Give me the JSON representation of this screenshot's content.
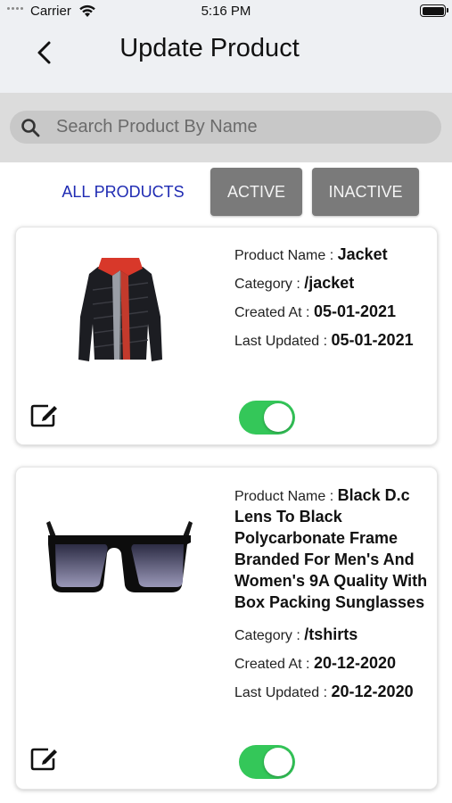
{
  "status_bar": {
    "carrier": "Carrier",
    "time": "5:16 PM"
  },
  "header": {
    "title": "Update Product",
    "back_icon": "chevron-left-icon"
  },
  "search": {
    "placeholder": "Search Product By Name",
    "value": "",
    "icon": "search-icon"
  },
  "filters": {
    "all": "ALL PRODUCTS",
    "active": "ACTIVE",
    "inactive": "INACTIVE",
    "selected": "ALL PRODUCTS"
  },
  "labels": {
    "product_name": "Product Name : ",
    "category": "Category : ",
    "created_at": "Created At : ",
    "last_updated": "Last Updated : "
  },
  "products": [
    {
      "name": "Jacket",
      "category": "/jacket",
      "created_at": "05-01-2021",
      "last_updated": "05-01-2021",
      "image": "jacket-image",
      "active": true
    },
    {
      "name": "Black D.c Lens To Black Polycarbonate Frame Branded For Men's And Women's 9A Quality With Box Packing Sunglasses",
      "category": "/tshirts",
      "created_at": "20-12-2020",
      "last_updated": "20-12-2020",
      "image": "sunglasses-image",
      "active": true
    }
  ],
  "colors": {
    "toggle_on": "#34c759",
    "accent_link": "#1f2bb3",
    "tab_button": "#7a7a7a",
    "header_bg": "#eef0f3"
  }
}
